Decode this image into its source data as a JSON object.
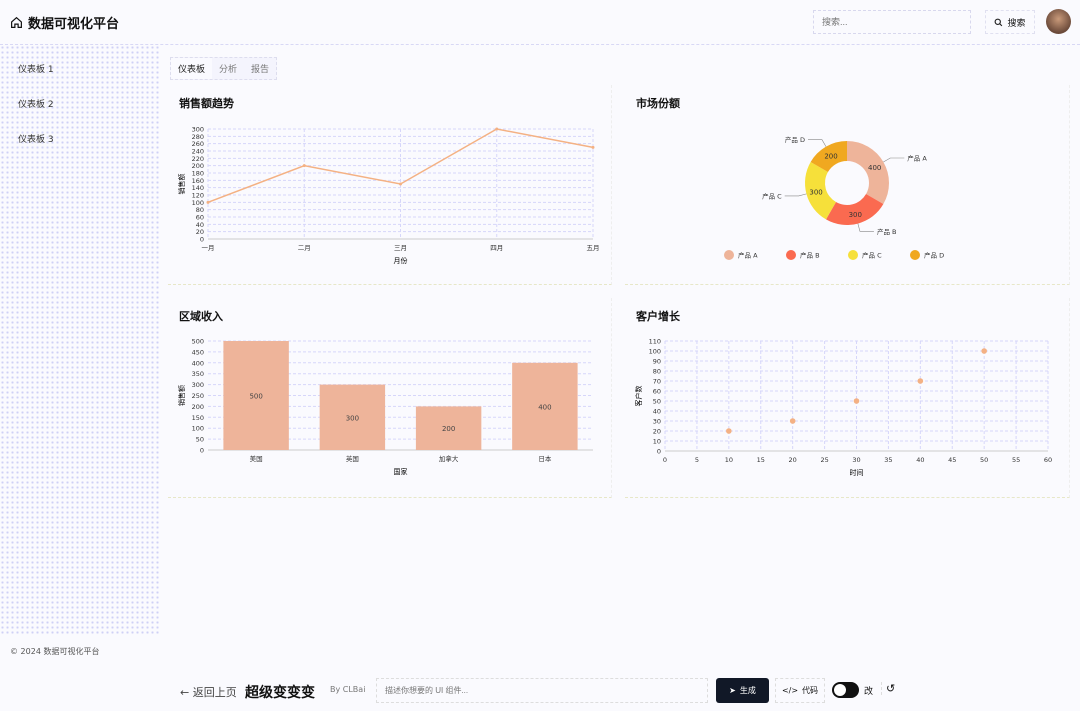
{
  "header": {
    "title": "数据可视化平台",
    "search_placeholder": "搜索...",
    "search_button": "搜索"
  },
  "sidebar": {
    "items": [
      {
        "label": "仪表板 1"
      },
      {
        "label": "仪表板 2"
      },
      {
        "label": "仪表板 3"
      }
    ]
  },
  "tabs": [
    {
      "label": "仪表板"
    },
    {
      "label": "分析"
    },
    {
      "label": "报告"
    }
  ],
  "cards": {
    "sales": "销售额趋势",
    "market": "市场份额",
    "region": "区域收入",
    "growth": "客户增长"
  },
  "footer": "© 2024 数据可视化平台",
  "bottom": {
    "back": "返回上页",
    "brand": "超级变变变",
    "by": "By CLBai",
    "prompt_placeholder": "描述你想要的 UI 组件...",
    "generate": "生成",
    "code": "代码",
    "toggle_label": "改",
    "history_icon": "↺"
  },
  "colors": {
    "line": "#f4b183",
    "bar": "#eeb49a",
    "pieA": "#eeb49a",
    "pieB": "#fa6a50",
    "pieC": "#f6e03a",
    "pieD": "#f0a820",
    "grid": "#d6d6fa"
  },
  "chart_data": [
    {
      "type": "line",
      "title": "销售额趋势",
      "categories": [
        "一月",
        "二月",
        "三月",
        "四月",
        "五月"
      ],
      "values": [
        100,
        200,
        150,
        300,
        250
      ],
      "xlabel": "月份",
      "ylabel": "销售额",
      "ylim": [
        0,
        300
      ],
      "yticks": [
        0,
        20,
        40,
        60,
        80,
        100,
        120,
        140,
        160,
        180,
        200,
        220,
        240,
        260,
        280,
        300
      ]
    },
    {
      "type": "pie",
      "title": "市场份额",
      "categories": [
        "产品 A",
        "产品 B",
        "产品 C",
        "产品 D"
      ],
      "values": [
        400,
        300,
        300,
        200
      ],
      "legend": "bottom"
    },
    {
      "type": "bar",
      "title": "区域收入",
      "categories": [
        "美国",
        "英国",
        "加拿大",
        "日本"
      ],
      "values": [
        500,
        300,
        200,
        400
      ],
      "xlabel": "国家",
      "ylabel": "销售额",
      "ylim": [
        0,
        500
      ],
      "yticks": [
        0,
        50,
        100,
        150,
        200,
        250,
        300,
        350,
        400,
        450,
        500
      ]
    },
    {
      "type": "scatter",
      "title": "客户增长",
      "x": [
        10,
        20,
        30,
        40,
        50
      ],
      "y": [
        20,
        30,
        50,
        70,
        100
      ],
      "xlabel": "时间",
      "ylabel": "客户数",
      "xlim": [
        0,
        60
      ],
      "ylim": [
        0,
        110
      ],
      "xticks": [
        0,
        5,
        10,
        15,
        20,
        25,
        30,
        35,
        40,
        45,
        50,
        55,
        60
      ],
      "yticks": [
        0,
        10,
        20,
        30,
        40,
        50,
        60,
        70,
        80,
        90,
        100,
        110
      ]
    }
  ]
}
